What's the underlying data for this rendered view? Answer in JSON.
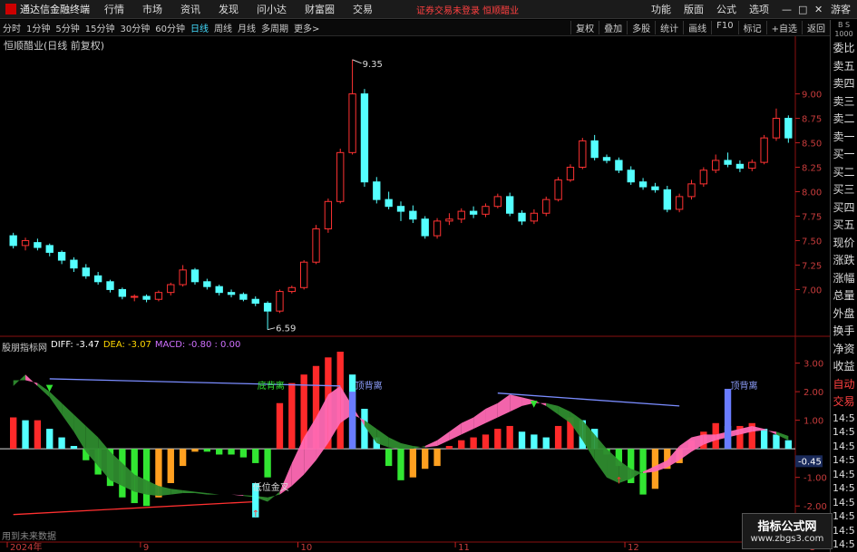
{
  "app": {
    "title": "通达信金融终端",
    "menu": [
      "行情",
      "市场",
      "资讯",
      "发现",
      "问小达",
      "财富圈",
      "交易"
    ],
    "notice": "证券交易未登录  恒顺醋业",
    "right_menu": [
      "功能",
      "版面",
      "公式",
      "选项"
    ],
    "guest": "游客",
    "window_controls": [
      "—",
      "□",
      "✕"
    ]
  },
  "periods": [
    "分时",
    "1分钟",
    "5分钟",
    "15分钟",
    "30分钟",
    "60分钟",
    "日线",
    "周线",
    "月线",
    "多周期",
    "更多>"
  ],
  "active_period": "日线",
  "toolbar_right": [
    "复权",
    "叠加",
    "多股",
    "统计",
    "画线",
    "F10",
    "标记",
    "+自选",
    "返回"
  ],
  "main_title": "恒顺醋业(日线 前复权)",
  "right_panel": {
    "top": "B S",
    "top2": "1000",
    "items": [
      "委比",
      "卖五",
      "卖四",
      "卖三",
      "卖二",
      "卖一",
      "买一",
      "买二",
      "买三",
      "买四",
      "买五",
      "现价",
      "涨跌",
      "涨幅",
      "总量",
      "外盘",
      "换手",
      "净资",
      "收益",
      "自动",
      "交易"
    ],
    "times": [
      "14:5",
      "14:5",
      "14:5",
      "14:5",
      "14:5",
      "14:5",
      "14:5",
      "14:5",
      "14:5",
      "14:5"
    ]
  },
  "macd_title": {
    "indicator": "股朋指标网",
    "diff": "DIFF: -3.47",
    "dea": "DEA: -3.07",
    "macd": "MACD: -0.80 : 0.00"
  },
  "annotations": {
    "high": "9.35",
    "low": "6.59",
    "bottom_div": "底背离",
    "top_div_1": "顶背离",
    "top_div_2": "顶背离",
    "low_gold": "低位金叉",
    "current": "-0.45"
  },
  "x_labels": [
    {
      "label": "2024年",
      "i": 0
    },
    {
      "label": "9",
      "i": 11
    },
    {
      "label": "10",
      "i": 24
    },
    {
      "label": "11",
      "i": 37
    },
    {
      "label": "12",
      "i": 51
    },
    {
      "label": "1",
      "i": 66
    }
  ],
  "footer_note": "用到未来数据",
  "watermark": {
    "line1": "指标公式网",
    "line2": "www.zbgs3.com"
  },
  "colors": {
    "up": "#ff3232",
    "down": "#54ffff",
    "diff": "#ff69b4",
    "dea_band": "#2e8b2e",
    "bg": "#000000",
    "grid": "#8a1010"
  },
  "chart_data": {
    "type": "candlestick",
    "price_axis": {
      "ticks": [
        7.0,
        7.25,
        7.5,
        7.75,
        8.0,
        8.25,
        8.5,
        8.75,
        9.0
      ],
      "ylim": [
        6.55,
        9.45
      ]
    },
    "macd_axis": {
      "ticks": [
        3.0,
        2.0,
        1.0,
        -1.0,
        -2.0
      ],
      "ylim": [
        -2.85,
        3.4
      ]
    },
    "candles": [
      [
        7.55,
        7.45,
        7.58,
        7.42
      ],
      [
        7.45,
        7.5,
        7.53,
        7.4
      ],
      [
        7.48,
        7.43,
        7.52,
        7.4
      ],
      [
        7.45,
        7.38,
        7.47,
        7.34
      ],
      [
        7.38,
        7.3,
        7.4,
        7.26
      ],
      [
        7.3,
        7.22,
        7.33,
        7.18
      ],
      [
        7.22,
        7.14,
        7.26,
        7.11
      ],
      [
        7.14,
        7.08,
        7.18,
        7.05
      ],
      [
        7.08,
        7.0,
        7.1,
        6.97
      ],
      [
        7.0,
        6.93,
        7.02,
        6.9
      ],
      [
        6.93,
        6.93,
        6.95,
        6.88
      ],
      [
        6.93,
        6.9,
        6.95,
        6.87
      ],
      [
        6.9,
        6.97,
        6.99,
        6.88
      ],
      [
        6.97,
        7.05,
        7.07,
        6.94
      ],
      [
        7.05,
        7.2,
        7.25,
        7.03
      ],
      [
        7.2,
        7.08,
        7.22,
        7.05
      ],
      [
        7.08,
        7.03,
        7.11,
        7.0
      ],
      [
        7.03,
        6.97,
        7.05,
        6.94
      ],
      [
        6.97,
        6.95,
        7.0,
        6.92
      ],
      [
        6.95,
        6.9,
        6.97,
        6.88
      ],
      [
        6.9,
        6.86,
        6.93,
        6.83
      ],
      [
        6.86,
        6.78,
        6.88,
        6.59
      ],
      [
        6.78,
        6.98,
        7.0,
        6.76
      ],
      [
        6.98,
        7.02,
        7.04,
        6.96
      ],
      [
        7.02,
        7.28,
        7.3,
        7.0
      ],
      [
        7.28,
        7.62,
        7.66,
        7.26
      ],
      [
        7.62,
        7.9,
        7.93,
        7.58
      ],
      [
        7.9,
        8.4,
        8.44,
        7.88
      ],
      [
        8.4,
        9.0,
        9.35,
        8.38
      ],
      [
        9.0,
        8.1,
        9.05,
        8.05
      ],
      [
        8.1,
        7.92,
        8.15,
        7.88
      ],
      [
        7.92,
        7.85,
        8.0,
        7.82
      ],
      [
        7.85,
        7.8,
        7.9,
        7.7
      ],
      [
        7.8,
        7.72,
        7.86,
        7.68
      ],
      [
        7.72,
        7.55,
        7.75,
        7.52
      ],
      [
        7.55,
        7.7,
        7.73,
        7.52
      ],
      [
        7.7,
        7.72,
        7.78,
        7.66
      ],
      [
        7.72,
        7.8,
        7.83,
        7.68
      ],
      [
        7.8,
        7.77,
        7.85,
        7.73
      ],
      [
        7.77,
        7.85,
        7.88,
        7.74
      ],
      [
        7.85,
        7.95,
        7.98,
        7.83
      ],
      [
        7.95,
        7.78,
        7.99,
        7.75
      ],
      [
        7.78,
        7.7,
        7.81,
        7.66
      ],
      [
        7.7,
        7.78,
        7.82,
        7.67
      ],
      [
        7.78,
        7.92,
        7.95,
        7.75
      ],
      [
        7.92,
        8.12,
        8.15,
        7.9
      ],
      [
        8.12,
        8.25,
        8.28,
        8.1
      ],
      [
        8.25,
        8.52,
        8.55,
        8.23
      ],
      [
        8.52,
        8.35,
        8.58,
        8.32
      ],
      [
        8.35,
        8.32,
        8.38,
        8.29
      ],
      [
        8.32,
        8.22,
        8.35,
        8.19
      ],
      [
        8.22,
        8.1,
        8.26,
        8.07
      ],
      [
        8.1,
        8.05,
        8.14,
        8.02
      ],
      [
        8.05,
        8.02,
        8.09,
        7.99
      ],
      [
        8.02,
        7.82,
        8.06,
        7.79
      ],
      [
        7.82,
        7.95,
        7.98,
        7.79
      ],
      [
        7.95,
        8.08,
        8.12,
        7.92
      ],
      [
        8.08,
        8.22,
        8.25,
        8.05
      ],
      [
        8.22,
        8.32,
        8.38,
        8.19
      ],
      [
        8.32,
        8.28,
        8.4,
        8.25
      ],
      [
        8.28,
        8.24,
        8.32,
        8.2
      ],
      [
        8.24,
        8.3,
        8.33,
        8.21
      ],
      [
        8.3,
        8.55,
        8.58,
        8.28
      ],
      [
        8.55,
        8.75,
        8.85,
        8.52
      ],
      [
        8.75,
        8.55,
        8.78,
        8.5
      ]
    ],
    "macd": {
      "histogram": [
        1.1,
        1.0,
        1.0,
        0.7,
        0.4,
        0.1,
        -0.4,
        -0.9,
        -1.3,
        -1.7,
        -1.9,
        -2.0,
        -1.7,
        -1.2,
        -0.6,
        -0.1,
        -0.1,
        -0.2,
        -0.2,
        -0.3,
        -0.5,
        -1.0,
        1.6,
        2.3,
        2.6,
        2.9,
        3.2,
        3.4,
        2.6,
        1.4,
        0.4,
        -0.6,
        -1.1,
        -1.0,
        -0.7,
        -0.6,
        0.1,
        0.3,
        0.4,
        0.5,
        0.7,
        0.8,
        0.6,
        0.5,
        0.4,
        0.8,
        1.1,
        1.0,
        0.7,
        -0.2,
        -0.6,
        -1.2,
        -1.6,
        -1.4,
        -0.7,
        -0.5,
        0.3,
        0.6,
        0.9,
        0.8,
        0.8,
        0.9,
        0.7,
        0.5,
        0.3
      ],
      "diff": [
        2.2,
        2.6,
        2.2,
        1.8,
        1.2,
        0.6,
        -0.1,
        -0.6,
        -1.1,
        -1.3,
        -1.5,
        -1.6,
        -1.65,
        -1.6,
        -1.55,
        -1.55,
        -1.6,
        -1.6,
        -1.6,
        -1.65,
        -1.7,
        -1.85,
        -1.5,
        -0.5,
        0.4,
        1.1,
        1.9,
        2.2,
        1.5,
        0.8,
        0.2,
        0.05,
        0.0,
        0.0,
        0.1,
        0.3,
        0.6,
        0.9,
        1.1,
        1.4,
        1.6,
        1.9,
        1.8,
        1.7,
        1.5,
        1.2,
        0.9,
        0.3,
        -0.4,
        -1.0,
        -1.2,
        -1.05,
        -0.8,
        -0.6,
        -0.4,
        0.1,
        0.4,
        0.5,
        0.5,
        0.6,
        0.7,
        0.8,
        0.7,
        0.5,
        0.3
      ],
      "dea": [
        2.4,
        2.4,
        2.3,
        2.0,
        1.6,
        1.2,
        0.8,
        0.4,
        -0.1,
        -0.5,
        -0.9,
        -1.1,
        -1.3,
        -1.4,
        -1.45,
        -1.5,
        -1.55,
        -1.6,
        -1.6,
        -1.62,
        -1.65,
        -1.7,
        -1.6,
        -1.3,
        -0.9,
        -0.4,
        0.2,
        0.9,
        1.2,
        1.0,
        0.7,
        0.4,
        0.2,
        0.1,
        0.05,
        0.1,
        0.3,
        0.5,
        0.7,
        0.9,
        1.1,
        1.3,
        1.5,
        1.6,
        1.6,
        1.5,
        1.3,
        1.0,
        0.5,
        0.0,
        -0.4,
        -0.7,
        -0.85,
        -0.8,
        -0.65,
        -0.4,
        -0.1,
        0.15,
        0.3,
        0.4,
        0.5,
        0.6,
        0.65,
        0.6,
        0.45
      ]
    }
  }
}
